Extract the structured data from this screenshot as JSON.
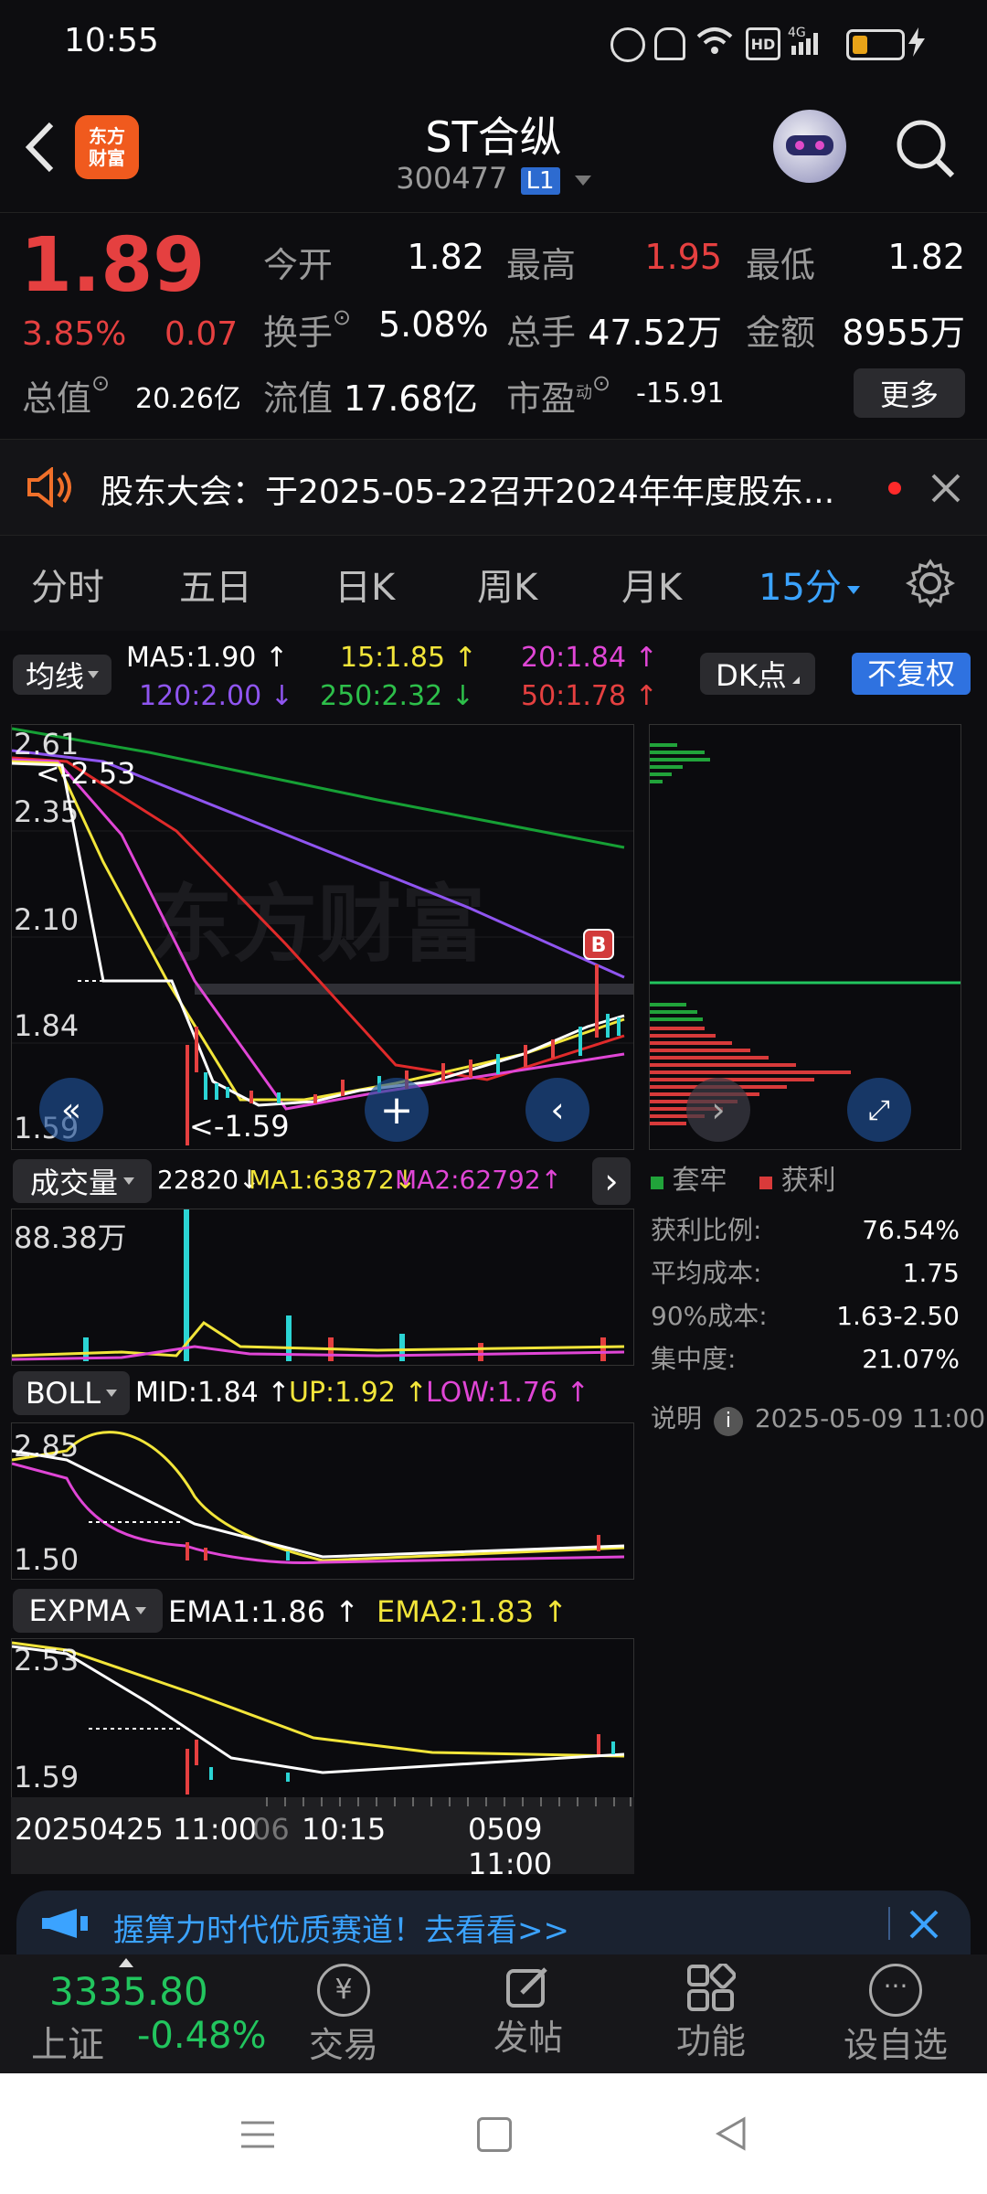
{
  "status_bar": {
    "time": "10:55"
  },
  "header": {
    "logo_text": "东方财富",
    "title": "ST合纵",
    "code": "300477",
    "level_badge": "L1"
  },
  "quote": {
    "price": "1.89",
    "change_percent": "3.85%",
    "change": "0.07",
    "open_label": "今开",
    "open": "1.82",
    "high_label": "最高",
    "high": "1.95",
    "low_label": "最低",
    "low": "1.82",
    "turnover_label": "换手",
    "turnover": "5.08%",
    "volume_label": "总手",
    "volume": "47.52万",
    "amount_label": "金额",
    "amount": "8955万",
    "market_cap_label": "总值",
    "market_cap": "20.26亿",
    "float_cap_label": "流值",
    "float_cap": "17.68亿",
    "pe_label": "市盈",
    "pe_sup": "动",
    "pe": "-15.91",
    "more_button": "更多"
  },
  "notice": {
    "text": "股东大会：于2025-05-22召开2024年年度股东..."
  },
  "tabs": [
    {
      "label": "分时"
    },
    {
      "label": "五日"
    },
    {
      "label": "日K"
    },
    {
      "label": "周K"
    },
    {
      "label": "月K"
    },
    {
      "label": "15分"
    }
  ],
  "ma_bar": {
    "selector": "均线",
    "ma5": "MA5:1.90",
    "ma15": "15:1.85",
    "ma20": "20:1.84",
    "ma120": "120:2.00",
    "ma250": "250:2.32",
    "ma50": "50:1.78",
    "dk_button": "DK点",
    "restore_button": "不复权"
  },
  "main_chart": {
    "y_labels": [
      "2.61",
      "2.35",
      "2.10",
      "1.84",
      "1.59"
    ],
    "max_marker": "<-2.53",
    "min_marker": "<-1.59",
    "b_marker": "B",
    "watermark": "东方财富"
  },
  "volume_bar": {
    "selector": "成交量",
    "value": "22820",
    "ma1": "MA1:63872",
    "ma2": "MA2:62792",
    "y_label": "88.38万"
  },
  "boll_bar": {
    "selector": "BOLL",
    "mid": "MID:1.84",
    "up": "UP:1.92",
    "low": "LOW:1.76",
    "y_top": "2.85",
    "y_bottom": "1.50"
  },
  "expma_bar": {
    "selector": "EXPMA",
    "ema1": "EMA1:1.86",
    "ema2": "EMA2:1.83",
    "y_top": "2.53",
    "y_bottom": "1.59"
  },
  "x_axis": {
    "left": "20250425 11:00",
    "mid_faded": "06",
    "mid": "10:15",
    "right": "0509 11:00"
  },
  "chip": {
    "legend_trapped": "套牢",
    "legend_profit": "获利",
    "rows": [
      {
        "label": "获利比例:",
        "value": "76.54%"
      },
      {
        "label": "平均成本:",
        "value": "1.75"
      },
      {
        "label": "90%成本:",
        "value": "1.63-2.50"
      },
      {
        "label": "集中度:",
        "value": "21.07%"
      }
    ],
    "note_label": "说明",
    "note_time": "2025-05-09 11:00"
  },
  "ad_banner": {
    "text": "握算力时代优质赛道！去看看>>"
  },
  "bottom_nav": {
    "index_value": "3335.80",
    "index_name": "上证",
    "index_change": "-0.48%",
    "items": [
      {
        "label": "交易"
      },
      {
        "label": "发帖"
      },
      {
        "label": "功能"
      },
      {
        "label": "设自选"
      }
    ]
  },
  "colors": {
    "up": "#e54040",
    "down": "#22c55e",
    "accent": "#3ba3ff",
    "ma5": "#ffffff",
    "ma15": "#f2e53a",
    "ma20": "#e046d6",
    "ma120": "#9b4cf2",
    "ma250": "#22a83a",
    "ma50": "#e02a2a"
  }
}
